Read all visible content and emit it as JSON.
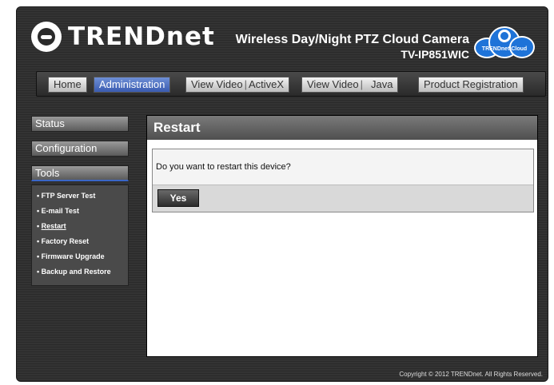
{
  "brand": {
    "logo_text": "TRENDnet",
    "product_name": "Wireless Day/Night PTZ Cloud Camera",
    "model": "TV-IP851WIC",
    "cloud_badge": "TRENDnet Cloud"
  },
  "nav": {
    "home": "Home",
    "administration": "Administration",
    "view_video_activex_1": "View Video",
    "view_video_activex_2": "ActiveX",
    "view_video_java_1": "View Video",
    "view_video_java_2": "Java",
    "product_registration": "Product Registration",
    "active": "Administration"
  },
  "sidebar": {
    "status": "Status",
    "configuration": "Configuration",
    "tools": "Tools",
    "items": [
      {
        "label": "FTP Server Test"
      },
      {
        "label": "E-mail Test"
      },
      {
        "label": "Restart",
        "current": true
      },
      {
        "label": "Factory Reset"
      },
      {
        "label": "Firmware Upgrade"
      },
      {
        "label": "Backup and Restore"
      }
    ]
  },
  "main": {
    "title": "Restart",
    "message": "Do you want to restart this device?",
    "yes_label": "Yes"
  },
  "footer": {
    "copyright": "Copyright © 2012 TRENDnet.  All Rights Reserved."
  },
  "colors": {
    "background": "#2f2f2f",
    "accent_blue": "#3a5bb0",
    "cloud_blue": "#1e73d8"
  }
}
